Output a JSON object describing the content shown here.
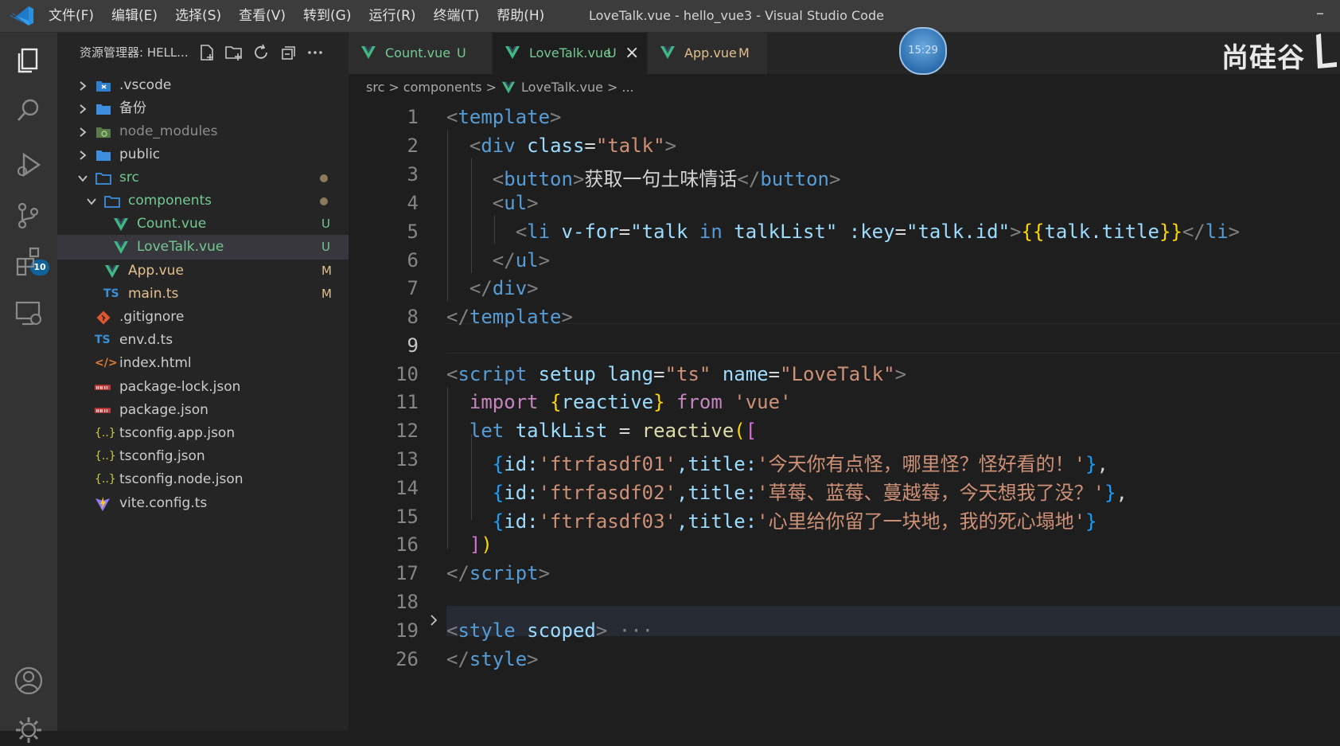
{
  "titlebar": {
    "menu": [
      "文件(F)",
      "编辑(E)",
      "选择(S)",
      "查看(V)",
      "转到(G)",
      "运行(R)",
      "终端(T)",
      "帮助(H)"
    ],
    "window_title": "LoveTalk.vue - hello_vue3 - Visual Studio Code"
  },
  "activity_bar": {
    "icons": [
      "explorer-icon",
      "search-icon",
      "run-debug-icon",
      "source-control-icon",
      "extensions-icon",
      "remote-explorer-icon",
      "account-icon",
      "settings-gear-icon"
    ],
    "source_control_badge": "10"
  },
  "sidebar": {
    "title": "资源管理器: HELL...",
    "actions": [
      "new-file-icon",
      "new-folder-icon",
      "refresh-icon",
      "collapse-all-icon",
      "more-actions-icon"
    ],
    "tree": [
      {
        "name": ".vscode",
        "type": "folder",
        "expanded": false,
        "icon": "vscode-folder-icon",
        "status": ""
      },
      {
        "name": "备份",
        "type": "folder",
        "expanded": false,
        "icon": "folder-icon",
        "status": ""
      },
      {
        "name": "node_modules",
        "type": "folder",
        "expanded": false,
        "icon": "node-folder-icon",
        "status": ""
      },
      {
        "name": "public",
        "type": "folder",
        "expanded": false,
        "icon": "folder-icon",
        "status": ""
      },
      {
        "name": "src",
        "type": "folder",
        "expanded": true,
        "icon": "folder-open-icon",
        "status": "dot"
      },
      {
        "name": "components",
        "type": "folder",
        "expanded": true,
        "icon": "folder-open-icon",
        "status": "dot"
      },
      {
        "name": "Count.vue",
        "type": "vue",
        "icon": "vue-icon",
        "status": "U"
      },
      {
        "name": "LoveTalk.vue",
        "type": "vue",
        "icon": "vue-icon",
        "status": "U",
        "selected": true
      },
      {
        "name": "App.vue",
        "type": "vue",
        "icon": "vue-icon",
        "status": "M"
      },
      {
        "name": "main.ts",
        "type": "ts",
        "icon": "typescript-icon",
        "status": "M"
      },
      {
        "name": ".gitignore",
        "type": "git",
        "icon": "git-icon",
        "status": ""
      },
      {
        "name": "env.d.ts",
        "type": "ts",
        "icon": "typescript-icon",
        "status": ""
      },
      {
        "name": "index.html",
        "type": "html",
        "icon": "html-icon",
        "status": ""
      },
      {
        "name": "package-lock.json",
        "type": "npm",
        "icon": "npm-icon",
        "status": ""
      },
      {
        "name": "package.json",
        "type": "npm",
        "icon": "npm-icon",
        "status": ""
      },
      {
        "name": "tsconfig.app.json",
        "type": "json",
        "icon": "json-icon",
        "status": ""
      },
      {
        "name": "tsconfig.json",
        "type": "json",
        "icon": "json-icon",
        "status": ""
      },
      {
        "name": "tsconfig.node.json",
        "type": "json",
        "icon": "json-icon",
        "status": ""
      },
      {
        "name": "vite.config.ts",
        "type": "vite",
        "icon": "vite-icon",
        "status": ""
      }
    ]
  },
  "tabs": [
    {
      "label": "Count.vue",
      "status": "U",
      "active": false
    },
    {
      "label": "LoveTalk.vue",
      "status": "U",
      "active": true,
      "close": "×"
    },
    {
      "label": "App.vue",
      "status": "M",
      "active": false
    }
  ],
  "clock": "15:29",
  "watermark": "尚硅谷",
  "breadcrumb": [
    "src",
    "components",
    "LoveTalk.vue",
    "..."
  ],
  "editor": {
    "active_line": "9",
    "lines": [
      {
        "n": "1"
      },
      {
        "n": "2"
      },
      {
        "n": "3"
      },
      {
        "n": "4"
      },
      {
        "n": "5"
      },
      {
        "n": "6"
      },
      {
        "n": "7"
      },
      {
        "n": "8"
      },
      {
        "n": "9"
      },
      {
        "n": "10"
      },
      {
        "n": "11"
      },
      {
        "n": "12"
      },
      {
        "n": "13"
      },
      {
        "n": "14"
      },
      {
        "n": "15"
      },
      {
        "n": "16"
      },
      {
        "n": "17"
      },
      {
        "n": "18"
      },
      {
        "n": "19"
      },
      {
        "n": "26"
      }
    ],
    "code": {
      "l1": {
        "t1": "template"
      },
      "l2": {
        "t1": "div",
        "a1": "class",
        "s1": "\"talk\""
      },
      "l3": {
        "t1": "button",
        "text": "获取一句土味情话",
        "t2": "button"
      },
      "l4": {
        "t1": "ul"
      },
      "l5": {
        "t1": "li",
        "a1": "v-for",
        "s1": "\"talk ",
        "kw": "in",
        "s2": " talkList\"",
        "a2": ":key",
        "s3": "\"talk.id\"",
        "b1": "{{",
        "v": "talk.title",
        "b2": "}}",
        "t2": "li"
      },
      "l6": {
        "t1": "ul"
      },
      "l7": {
        "t1": "div"
      },
      "l8": {
        "t1": "template"
      },
      "l10": {
        "t1": "script",
        "a1": "setup",
        "a2": "lang",
        "s1": "\"ts\"",
        "a3": "name",
        "s2": "\"LoveTalk\""
      },
      "l11": {
        "k1": "import",
        "b1": "{",
        "v": "reactive",
        "b2": "}",
        "k2": "from",
        "s1": "'vue'"
      },
      "l12": {
        "k1": "let",
        "v": "talkList",
        "op": "=",
        "f": "reactive",
        "b1": "(",
        "b2": "["
      },
      "l13": {
        "b1": "{",
        "p1": "id:",
        "s1": "'ftrfasdf01'",
        "p2": ",title:",
        "s2": "'今天你有点怪，哪里怪？怪好看的！'",
        "b2": "}",
        "tail": ","
      },
      "l14": {
        "b1": "{",
        "p1": "id:",
        "s1": "'ftrfasdf02'",
        "p2": ",title:",
        "s2": "'草莓、蓝莓、蔓越莓，今天想我了没？'",
        "b2": "}",
        "tail": ","
      },
      "l15": {
        "b1": "{",
        "p1": "id:",
        "s1": "'ftrfasdf03'",
        "p2": ",title:",
        "s2": "'心里给你留了一块地，我的死心塌地'",
        "b2": "}"
      },
      "l16": {
        "b1": "]",
        "b2": ")"
      },
      "l17": {
        "t1": "script"
      },
      "l19": {
        "t1": "style",
        "a1": "scoped",
        "ellipsis": "···"
      },
      "l26": {
        "t1": "style"
      }
    }
  },
  "colors": {
    "accent": "#007acc",
    "vue_green": "#41b883",
    "untracked": "#73c991",
    "modified": "#e2c08d"
  }
}
